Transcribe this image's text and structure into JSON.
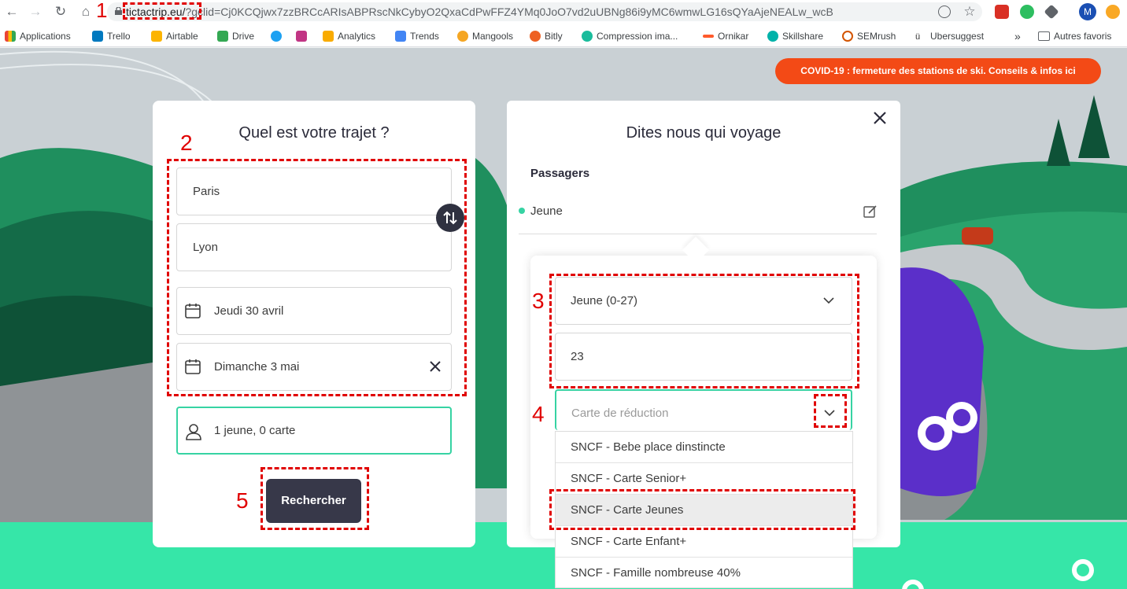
{
  "browser": {
    "url_host": "tictactrip.eu/",
    "url_rest": "?gclid=Cj0KCQjwx7zzBRCcARIsABPRscNkCybyO2QxaCdPwFFZ4YMq0JoO7vd2uUBNg86i9yMC6wmwLG16sQYaAjeNEALw_wcB",
    "profile_initial": "M",
    "bookmarks": [
      "Applications",
      "Trello",
      "Airtable",
      "Drive",
      "Analytics",
      "Trends",
      "Mangools",
      "Bitly",
      "Compression ima...",
      "Ornikar",
      "Skillshare",
      "SEMrush",
      "Ubersuggest",
      "Autres favoris"
    ],
    "overflow_label": "»"
  },
  "banner": {
    "text": "COVID-19 : fermeture des stations de ski. Conseils & infos ici",
    "color": "#f34a16"
  },
  "trip_form": {
    "title": "Quel est votre trajet ?",
    "origin": "Paris",
    "destination": "Lyon",
    "departure_date": "Jeudi 30 avril",
    "return_date": "Dimanche 3 mai",
    "passengers_summary": "1 jeune, 0 carte",
    "search_label": "Rechercher"
  },
  "passenger_panel": {
    "title": "Dites nous qui voyage",
    "section_label": "Passagers",
    "passenger_name": "Jeune",
    "age_category": "Jeune (0-27)",
    "age_value": "23",
    "card_placeholder": "Carte de réduction",
    "card_options": [
      "SNCF - Bebe place dinstincte",
      "SNCF - Carte Senior+",
      "SNCF - Carte Jeunes",
      "SNCF - Carte Enfant+",
      "SNCF - Famille nombreuse 40%"
    ],
    "highlighted_option_index": 2
  },
  "annotations": [
    "1",
    "2",
    "3",
    "4",
    "5"
  ],
  "colors": {
    "accent": "#36d3a3",
    "dark_button": "#373849",
    "annotation": "#e00000"
  }
}
